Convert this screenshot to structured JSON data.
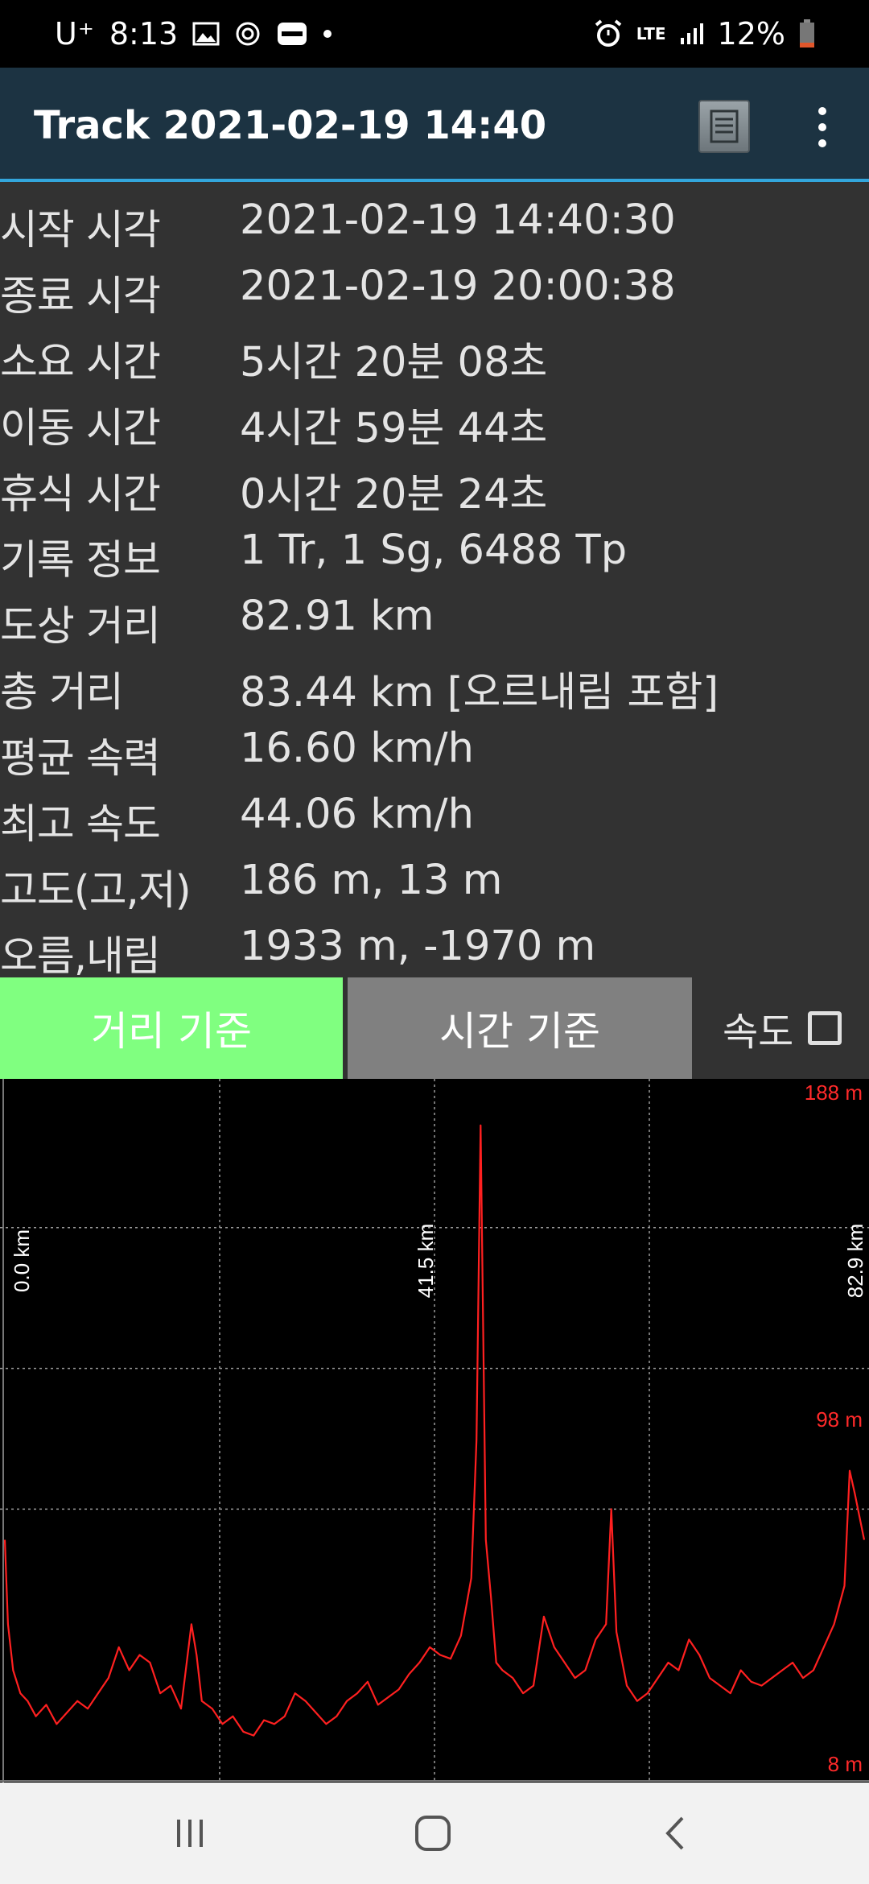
{
  "status_bar": {
    "carrier": "U⁺",
    "time": "8:13",
    "network": "LTE",
    "battery": "12%"
  },
  "app_bar": {
    "title": "Track 2021-02-19 14:40"
  },
  "info_rows": [
    {
      "label": "시작 시각",
      "value": "2021-02-19 14:40:30"
    },
    {
      "label": "종료 시각",
      "value": "2021-02-19 20:00:38"
    },
    {
      "label": "소요 시간",
      "value": "5시간 20분 08초"
    },
    {
      "label": "이동 시간",
      "value": "4시간 59분 44초"
    },
    {
      "label": "휴식 시간",
      "value": "0시간 20분 24초"
    },
    {
      "label": "기록 정보",
      "value": "1 Tr, 1 Sg, 6488 Tp"
    },
    {
      "label": "도상 거리",
      "value": "82.91 km"
    },
    {
      "label": "총 거리",
      "value": "83.44 km [오르내림 포함]"
    },
    {
      "label": "평균 속력",
      "value": "16.60 km/h"
    },
    {
      "label": "최고 속도",
      "value": "44.06 km/h"
    },
    {
      "label": "고도(고,저)",
      "value": "186 m, 13 m"
    },
    {
      "label": "오름,내림",
      "value": "1933 m, -1970 m"
    }
  ],
  "toggle": {
    "distance_label": "거리 기준",
    "time_label": "시간 기준",
    "speed_label": "속도",
    "speed_checked": false,
    "active": "distance"
  },
  "colors": {
    "active_button": "#80ff80",
    "inactive_button": "#808080",
    "app_bar": "#1c3342",
    "accent_line": "#33a6dc",
    "series": "#ff2020",
    "grid": "#9a9a9a"
  },
  "chart_data": {
    "type": "line",
    "title": "",
    "xlabel": "",
    "ylabel": "",
    "x_unit": "km",
    "y_unit": "m",
    "xlim": [
      0,
      82.9
    ],
    "ylim": [
      8,
      188
    ],
    "x_tick_labels": [
      "0.0 km",
      "41.5 km",
      "82.9 km"
    ],
    "y_tick_labels": [
      "188 m",
      "98 m",
      "8 m"
    ],
    "grid": true,
    "series": [
      {
        "x": [
          0,
          0.3,
          0.8,
          1.5,
          2.2,
          3.0,
          4.0,
          5.0,
          6.0,
          7.0,
          8.0,
          9.0,
          10.0,
          11.0,
          12.0,
          13.0,
          14.0,
          15.0,
          16.0,
          17.0,
          18.0,
          18.5,
          19.0,
          20.0,
          21.0,
          22.0,
          23.0,
          24.0,
          25.0,
          26.0,
          27.0,
          28.0,
          29.0,
          30.0,
          31.0,
          32.0,
          33.0,
          34.0,
          35.0,
          36.0,
          37.0,
          38.0,
          39.0,
          40.0,
          41.0,
          42.0,
          43.0,
          44.0,
          45.0,
          45.5,
          45.9,
          46.4,
          46.9,
          47.4,
          48.0,
          49.0,
          50.0,
          51.0,
          52.0,
          53.0,
          54.0,
          55.0,
          56.0,
          57.0,
          58.0,
          58.5,
          59.0,
          60.0,
          61.0,
          62.0,
          63.0,
          64.0,
          65.0,
          66.0,
          67.0,
          68.0,
          69.0,
          70.0,
          71.0,
          72.0,
          73.0,
          74.0,
          75.0,
          76.0,
          77.0,
          78.0,
          79.0,
          80.0,
          81.0,
          81.5,
          82.0,
          82.9
        ],
        "y": [
          70,
          48,
          36,
          30,
          28,
          24,
          27,
          22,
          25,
          28,
          26,
          30,
          34,
          42,
          36,
          40,
          38,
          30,
          32,
          26,
          48,
          40,
          28,
          26,
          22,
          24,
          20,
          19,
          23,
          22,
          24,
          30,
          28,
          25,
          22,
          24,
          28,
          30,
          33,
          27,
          29,
          31,
          35,
          38,
          42,
          40,
          39,
          45,
          60,
          96,
          178,
          70,
          55,
          38,
          36,
          34,
          30,
          32,
          50,
          42,
          38,
          34,
          36,
          44,
          48,
          78,
          46,
          32,
          28,
          30,
          34,
          38,
          36,
          44,
          40,
          34,
          32,
          30,
          36,
          33,
          32,
          34,
          36,
          38,
          34,
          36,
          42,
          48,
          58,
          88,
          82,
          70
        ]
      }
    ]
  }
}
